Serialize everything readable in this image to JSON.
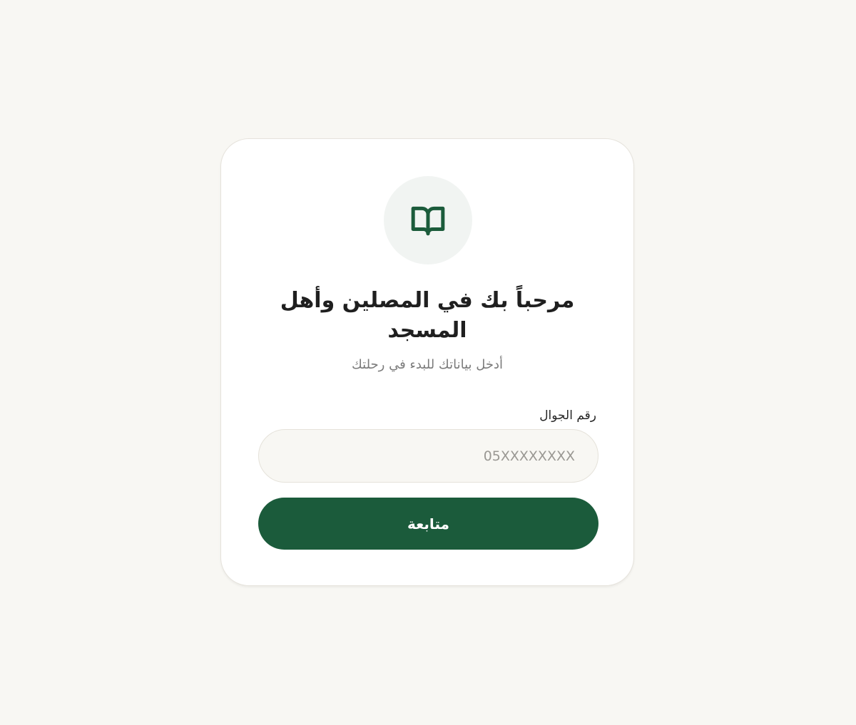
{
  "theme": {
    "background": "#f8f7f3",
    "card_background": "#ffffff",
    "accent": "#1b5b3b",
    "icon_circle_background": "#f1f4f2"
  },
  "login": {
    "icon": "open-book-icon",
    "title": "مرحباً بك في المصلين وأهل المسجد",
    "subtitle": "أدخل بياناتك للبدء في رحلتك",
    "phone_label": "رقم الجوال",
    "phone_value": "",
    "phone_placeholder": "05XXXXXXXX",
    "continue_label": "متابعة"
  }
}
